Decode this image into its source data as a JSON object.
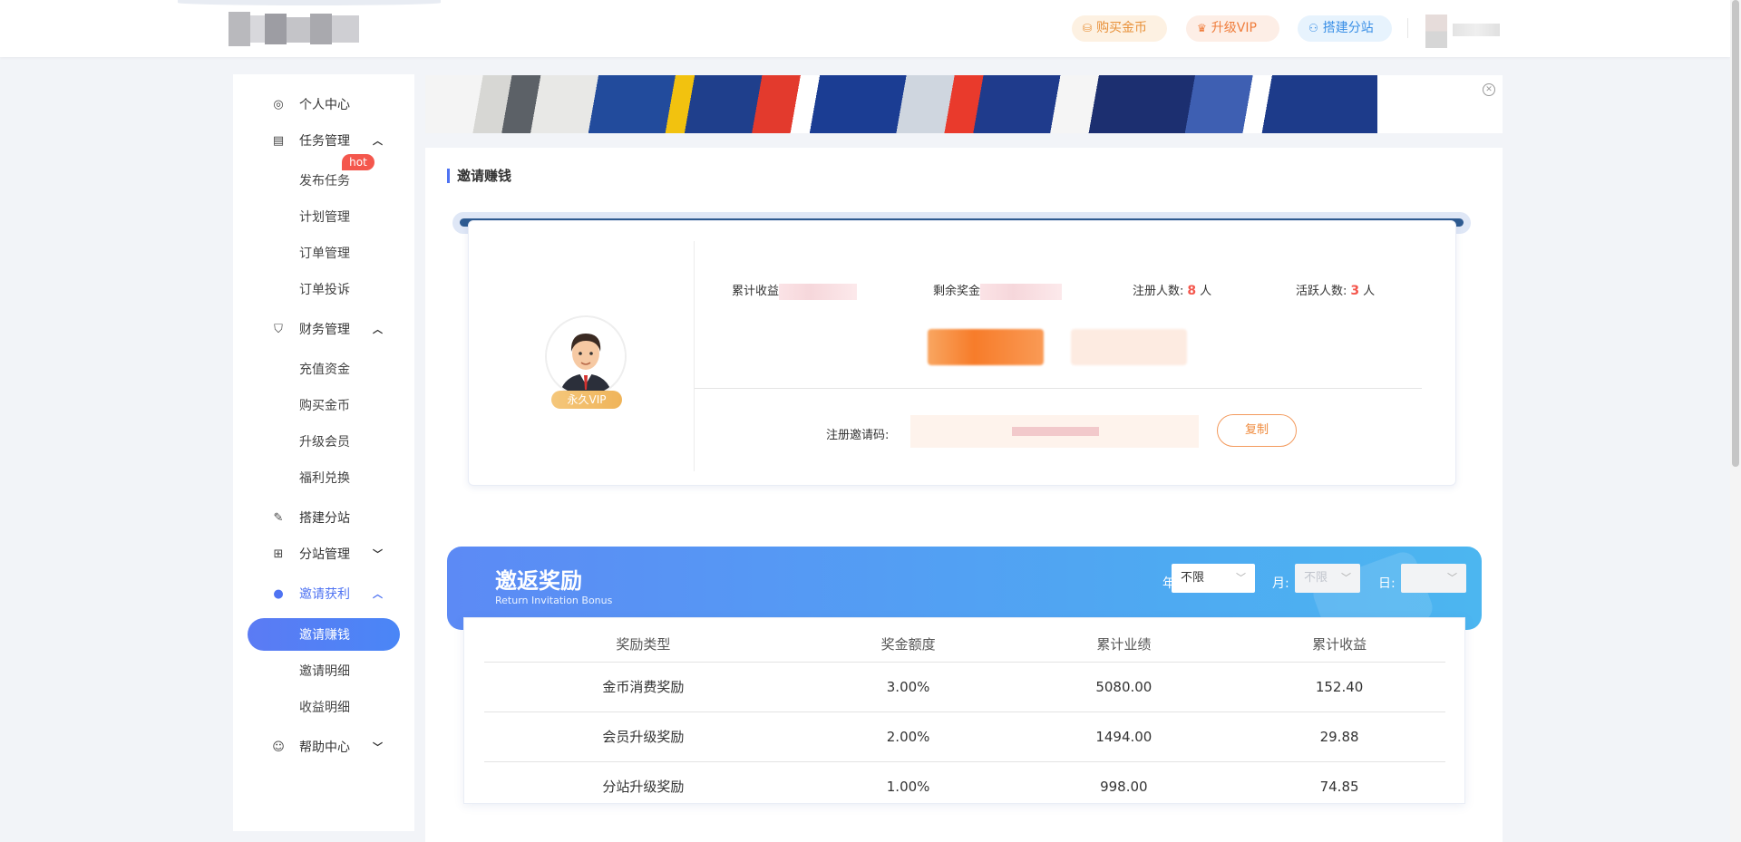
{
  "header": {
    "buy_gold": "购买金币",
    "upgrade_vip": "升级VIP",
    "build_branch": "搭建分站"
  },
  "sidebar": {
    "items": [
      {
        "label": "个人中心",
        "icon": "user-circle-icon"
      },
      {
        "label": "任务管理",
        "icon": "clipboard-icon"
      },
      {
        "label": "发布任务"
      },
      {
        "label": "计划管理"
      },
      {
        "label": "订单管理"
      },
      {
        "label": "订单投诉"
      },
      {
        "label": "财务管理",
        "icon": "shield-icon"
      },
      {
        "label": "充值资金"
      },
      {
        "label": "购买金币"
      },
      {
        "label": "升级会员"
      },
      {
        "label": "福利兑换"
      },
      {
        "label": "搭建分站",
        "icon": "wrench-icon"
      },
      {
        "label": "分站管理",
        "icon": "sitemap-icon"
      },
      {
        "label": "邀请获利",
        "icon": "person-icon"
      },
      {
        "label": "邀请赚钱"
      },
      {
        "label": "邀请明细"
      },
      {
        "label": "收益明细"
      },
      {
        "label": "帮助中心",
        "icon": "help-icon"
      }
    ],
    "hot_badge": "hot"
  },
  "page": {
    "title": "邀请赚钱"
  },
  "invite": {
    "vip_tag": "永久VIP",
    "total_income_label": "累计收益",
    "remaining_bonus_label": "剩余奖金",
    "registered_label": "注册人数:",
    "registered_count": "8",
    "registered_unit": "人",
    "active_label": "活跃人数:",
    "active_count": "3",
    "active_unit": "人",
    "code_label": "注册邀请码:",
    "copy_button": "复制"
  },
  "bonus": {
    "title": "邀返奖励",
    "subtitle": "Return Invitation Bonus",
    "filters": {
      "year_label": "年:",
      "year_value": "不限",
      "month_label": "月:",
      "month_value": "不限",
      "day_label": "日:",
      "day_value": ""
    },
    "columns": [
      "奖励类型",
      "奖金额度",
      "累计业绩",
      "累计收益"
    ],
    "rows": [
      [
        "金币消费奖励",
        "3.00%",
        "5080.00",
        "152.40"
      ],
      [
        "会员升级奖励",
        "2.00%",
        "1494.00",
        "29.88"
      ],
      [
        "分站升级奖励",
        "1.00%",
        "998.00",
        "74.85"
      ]
    ]
  },
  "colors": {
    "accent": "#4f73f2",
    "highlight_number": "#f4574d",
    "copy_button": "#ef8a3c"
  }
}
